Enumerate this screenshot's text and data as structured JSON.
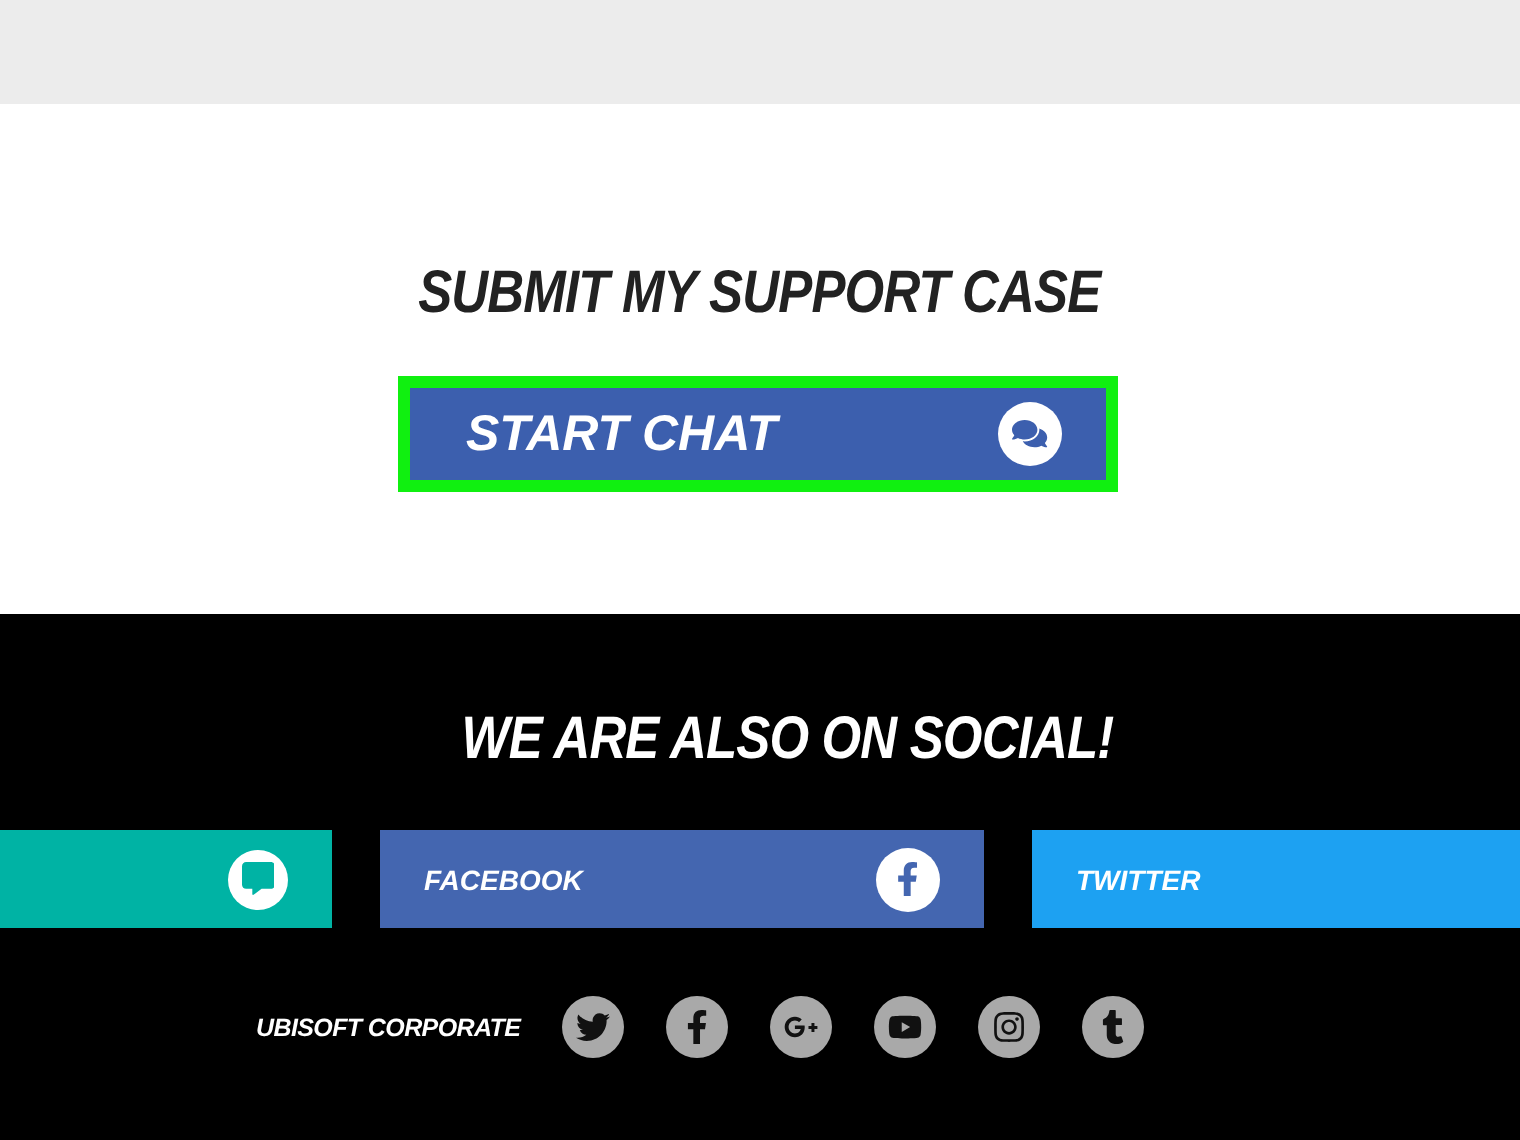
{
  "support": {
    "heading": "SUBMIT MY SUPPORT CASE",
    "chat_button": {
      "label": "START CHAT",
      "highlighted": true
    }
  },
  "social": {
    "heading": "WE ARE ALSO ON SOCIAL!",
    "cards": [
      {
        "kind": "chat",
        "color": "#00b3a4"
      },
      {
        "kind": "facebook",
        "label": "FACEBOOK",
        "color": "#4466b0"
      },
      {
        "kind": "twitter",
        "label": "TWITTER",
        "color": "#1da1f2"
      }
    ],
    "corporate": {
      "label": "UBISOFT CORPORATE",
      "links": [
        {
          "kind": "twitter"
        },
        {
          "kind": "facebook"
        },
        {
          "kind": "googleplus"
        },
        {
          "kind": "youtube"
        },
        {
          "kind": "instagram"
        },
        {
          "kind": "tumblr"
        }
      ]
    }
  }
}
